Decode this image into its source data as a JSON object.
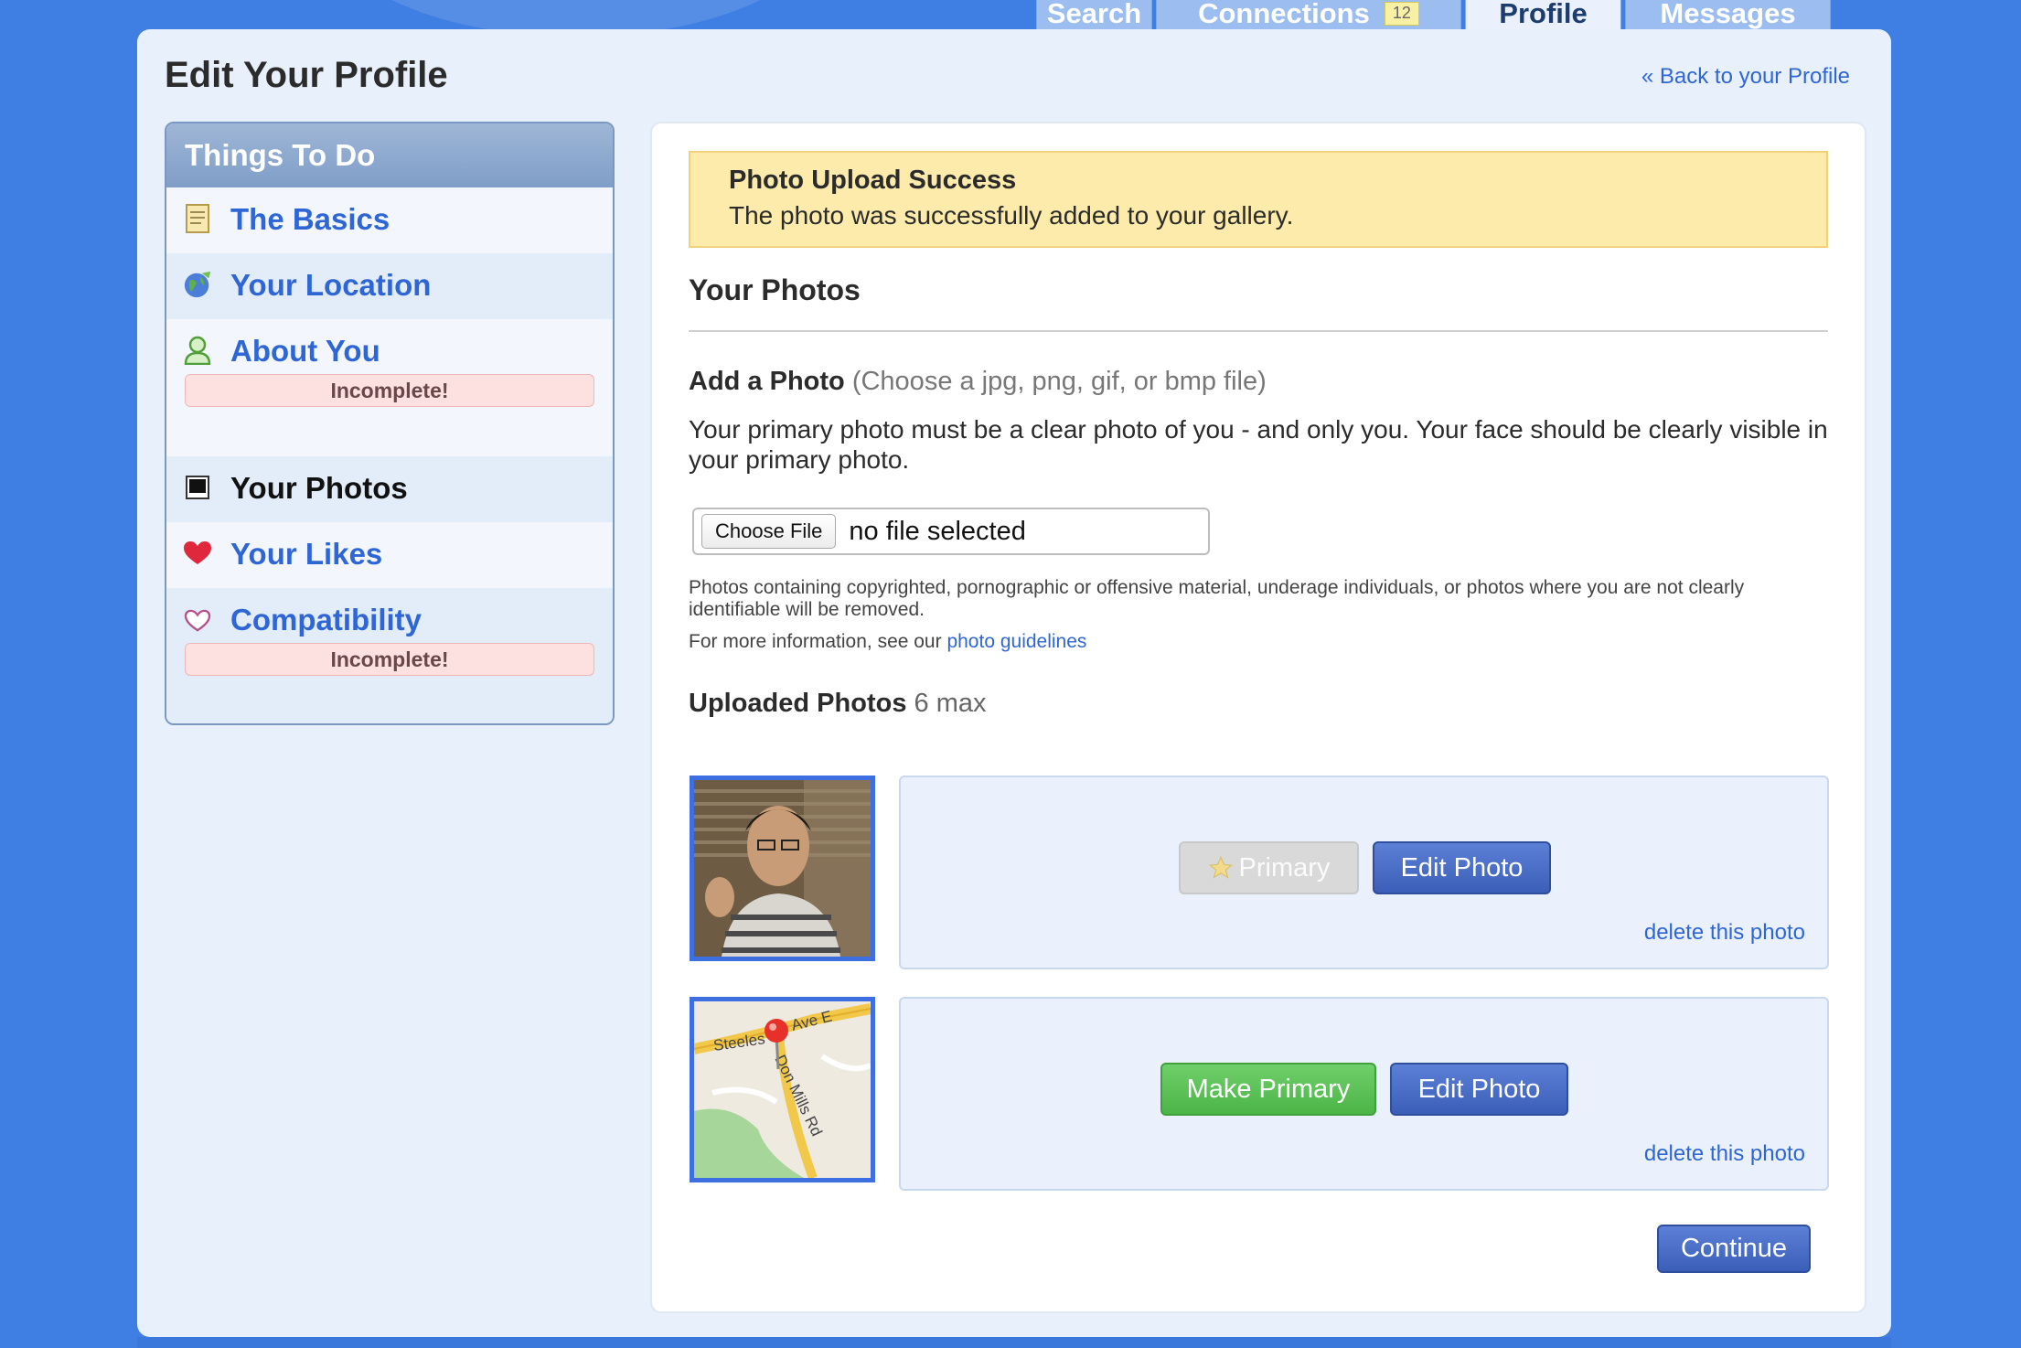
{
  "nav": {
    "tabs": [
      {
        "label": "Search"
      },
      {
        "label": "Connections",
        "badge": "12"
      },
      {
        "label": "Profile",
        "active": true
      },
      {
        "label": "Messages"
      }
    ]
  },
  "header": {
    "title": "Edit Your Profile",
    "back_link": "« Back to your Profile"
  },
  "sidebar": {
    "heading": "Things To Do",
    "items": [
      {
        "label": "The Basics",
        "icon": "document-icon"
      },
      {
        "label": "Your Location",
        "icon": "globe-icon"
      },
      {
        "label": "About You",
        "icon": "person-icon",
        "status": "Incomplete!"
      },
      {
        "label": "Your Photos",
        "icon": "photo-icon",
        "current": true
      },
      {
        "label": "Your Likes",
        "icon": "heart-icon"
      },
      {
        "label": "Compatibility",
        "icon": "heart-outline-icon",
        "status": "Incomplete!"
      }
    ]
  },
  "alert": {
    "title": "Photo Upload Success",
    "text": "The photo was successfully added to your gallery."
  },
  "photos_section": {
    "title": "Your Photos",
    "add_label": "Add a Photo",
    "add_hint": "(Choose a jpg, png, gif, or bmp file)",
    "primary_note": "Your primary photo must be a clear photo of you - and only you. Your face should be clearly visible in your primary photo.",
    "file_button": "Choose File",
    "file_status": "no file selected",
    "guidelines_text": "Photos containing copyrighted, pornographic or offensive material, underage individuals, or photos where you are not clearly identifiable will be removed.",
    "more_info_prefix": "For more information, see our",
    "more_info_link": "photo guidelines",
    "uploaded_label": "Uploaded Photos",
    "uploaded_max": "6 max",
    "photos": [
      {
        "primary_label": "Primary",
        "edit_label": "Edit Photo",
        "delete_label": "delete this photo"
      },
      {
        "primary_label": "Make Primary",
        "edit_label": "Edit Photo",
        "delete_label": "delete this photo"
      }
    ],
    "continue_label": "Continue"
  },
  "map_thumb": {
    "street_1": "Steeles",
    "street_2": "Ave E",
    "street_3": "Don Mills Rd"
  },
  "colors": {
    "background": "#3f7fe3",
    "link": "#2f66d6",
    "alert_bg": "#fcebab",
    "primary_btn": "#3b5eb8",
    "make_primary_btn": "#4cb548",
    "incomplete_bg": "#fde0e0"
  }
}
